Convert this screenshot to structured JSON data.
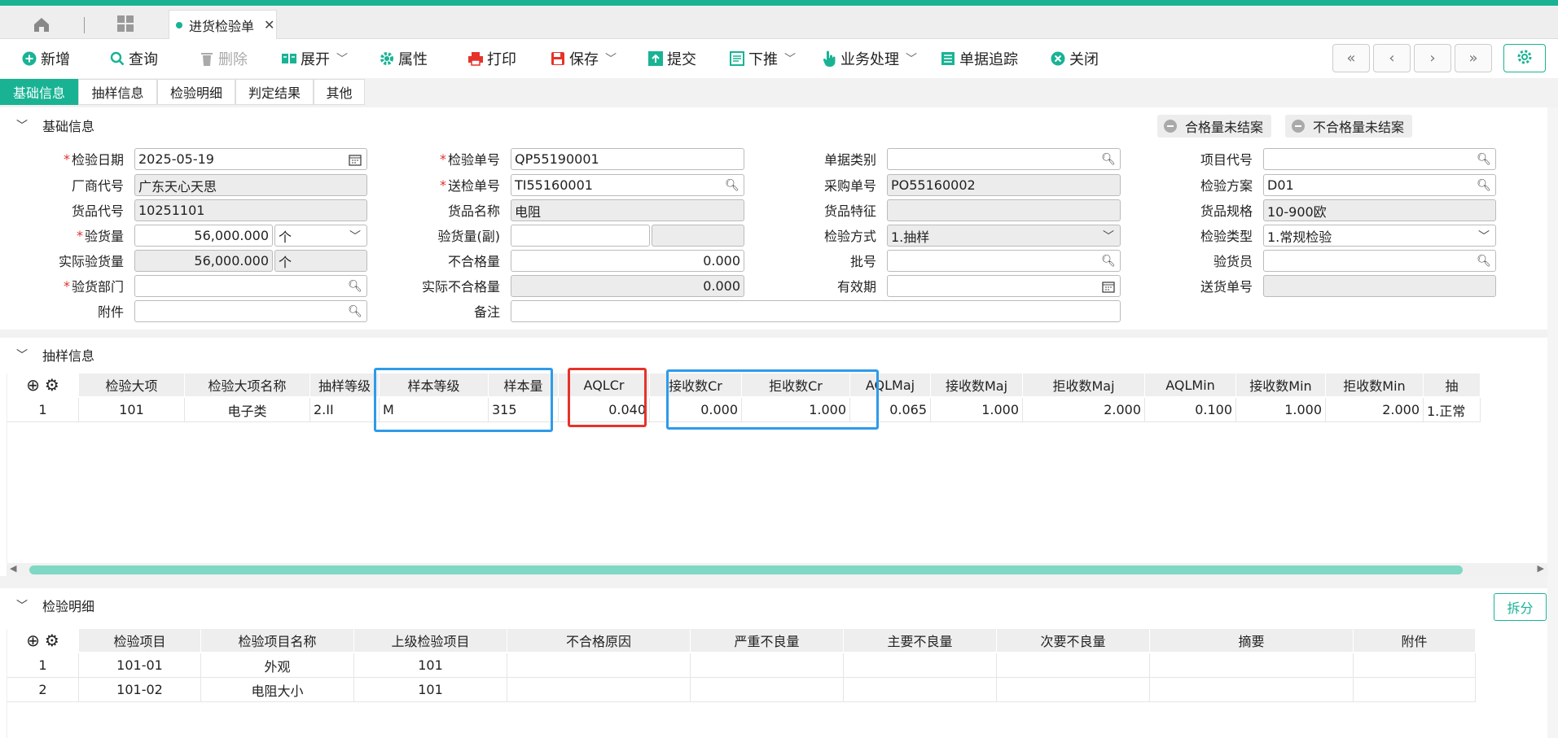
{
  "window": {
    "tab_title": "进货检验单",
    "accent": "#19b394"
  },
  "toolbar": {
    "new": "新增",
    "query": "查询",
    "delete": "删除",
    "expand": "展开",
    "attributes": "属性",
    "print": "打印",
    "save": "保存",
    "submit": "提交",
    "push_down": "下推",
    "business": "业务处理",
    "trace": "单据追踪",
    "close": "关闭"
  },
  "subtabs": [
    "基础信息",
    "抽样信息",
    "检验明细",
    "判定结果",
    "其他"
  ],
  "basic": {
    "title": "基础信息",
    "badge_pass": "合格量未结案",
    "badge_fail": "不合格量未结案",
    "labels": {
      "inspect_date": "检验日期",
      "vendor_code": "厂商代号",
      "goods_code": "货品代号",
      "inspect_qty": "验货量",
      "actual_qty": "实际验货量",
      "inspect_dept": "验货部门",
      "attachment": "附件",
      "inspect_no": "检验单号",
      "deliver_no": "送检单号",
      "goods_name": "货品名称",
      "inspect_qty_sub": "验货量(副)",
      "reject_qty": "不合格量",
      "actual_reject": "实际不合格量",
      "remark": "备注",
      "doc_type": "单据类别",
      "po_no": "采购单号",
      "goods_feature": "货品特征",
      "inspect_method": "检验方式",
      "batch_no": "批号",
      "expiry": "有效期",
      "project_code": "项目代号",
      "inspect_plan": "检验方案",
      "goods_spec": "货品规格",
      "inspect_type": "检验类型",
      "inspector": "验货员",
      "delivery_no": "送货单号"
    },
    "values": {
      "inspect_date": "2025-05-19",
      "vendor_code": "广东天心天思",
      "goods_code": "10251101",
      "inspect_qty": "56,000.000",
      "inspect_unit": "个",
      "actual_qty": "56,000.000",
      "actual_unit": "个",
      "inspect_no": "QP55190001",
      "deliver_no": "TI55160001",
      "goods_name": "电阻",
      "reject_qty": "0.000",
      "actual_reject": "0.000",
      "po_no": "PO55160002",
      "inspect_method": "1.抽样",
      "inspect_plan": "D01",
      "goods_spec": "10-900欧",
      "inspect_type": "1.常规检验"
    }
  },
  "sampling": {
    "title": "抽样信息",
    "headers": [
      "检验大项",
      "检验大项名称",
      "抽样等级",
      "样本等级",
      "样本量",
      "AQLCr",
      "接收数Cr",
      "拒收数Cr",
      "AQLMaj",
      "接收数Maj",
      "拒收数Maj",
      "AQLMin",
      "接收数Min",
      "拒收数Min",
      "抽"
    ],
    "rows": [
      {
        "idx": "1",
        "cells": [
          "101",
          "电子类",
          "2.II",
          "M",
          "315",
          "0.040",
          "0.000",
          "1.000",
          "0.065",
          "1.000",
          "2.000",
          "0.100",
          "1.000",
          "2.000",
          "1.正常"
        ]
      }
    ]
  },
  "detail": {
    "title": "检验明细",
    "split": "拆分",
    "headers": [
      "检验项目",
      "检验项目名称",
      "上级检验项目",
      "不合格原因",
      "严重不良量",
      "主要不良量",
      "次要不良量",
      "摘要",
      "附件"
    ],
    "rows": [
      {
        "idx": "1",
        "cells": [
          "101-01",
          "外观",
          "101",
          "",
          "",
          "",
          "",
          "",
          ""
        ]
      },
      {
        "idx": "2",
        "cells": [
          "101-02",
          "电阻大小",
          "101",
          "",
          "",
          "",
          "",
          "",
          ""
        ]
      }
    ]
  },
  "highlight_colors": {
    "blue": "#2f9be8",
    "red": "#e6332a"
  }
}
